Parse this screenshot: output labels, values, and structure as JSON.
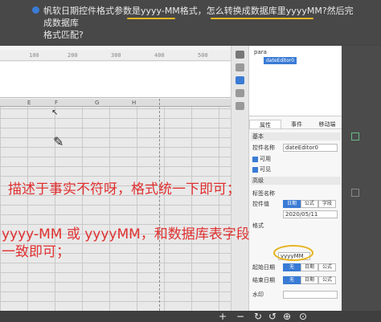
{
  "question": {
    "line1": "帆软日期控件格式参数是yyyy-MM格式，怎么转换成数据库里yyyyMM?然后完成数据库",
    "line2": "格式匹配?"
  },
  "ruler": [
    "100",
    "200",
    "300",
    "400",
    "500"
  ],
  "columns": [
    "E",
    "F",
    "G",
    "H"
  ],
  "tree": {
    "root": "para",
    "node": "dateEditor0"
  },
  "tabs": [
    "属性",
    "事件",
    "移动端"
  ],
  "panel": {
    "section_basic": "基本",
    "name_label": "控件名称",
    "name_value": "dateEditor0",
    "enabled": "可用",
    "visible": "可见",
    "advanced": "高级",
    "label_name": "标签名称",
    "value_label": "控件值",
    "value_options": [
      "日期",
      "公式",
      "字段"
    ],
    "date_value": "2020/05/11",
    "format_label": "格式",
    "format_value": "yyyyMM",
    "start_label": "起始日期",
    "end_label": "结束日期",
    "date_opts": [
      "无",
      "日期",
      "公式"
    ],
    "watermark_label": "水印"
  },
  "annotations": {
    "line1": "描述于事实不符呀，格式统一下即可；",
    "line2": "yyyy-MM 或 yyyyMM，和数据库表字段",
    "line3": "一致即可；"
  },
  "bottom_bar": [
    "+",
    "−",
    "↻",
    "↺",
    "⊕",
    "⊙"
  ]
}
